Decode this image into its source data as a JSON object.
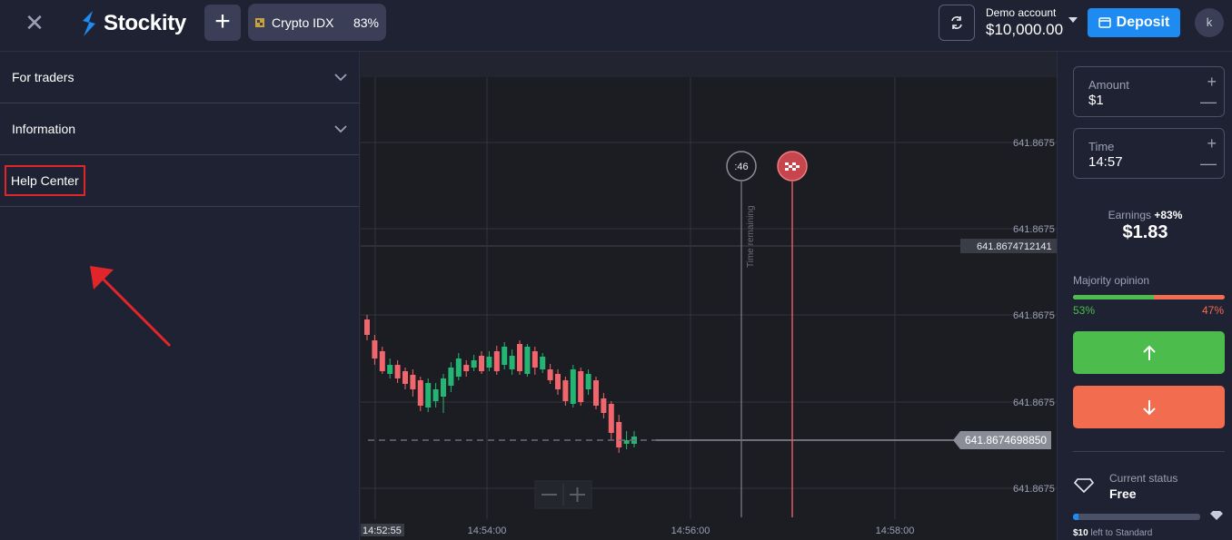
{
  "header": {
    "logo_text": "Stockity",
    "asset": {
      "name": "Crypto IDX",
      "payout": "83%"
    },
    "account": {
      "label": "Demo account",
      "balance": "$10,000.00"
    },
    "deposit_label": "Deposit",
    "avatar_initial": "k"
  },
  "sidebar": {
    "items": [
      {
        "label": "For traders",
        "expandable": true
      },
      {
        "label": "Information",
        "expandable": true
      },
      {
        "label": "Help Center",
        "expandable": false,
        "highlighted": true
      }
    ]
  },
  "chart": {
    "price_ticks": [
      "641.8675",
      "641.8675",
      "641.8675",
      "641.8675",
      "641.8675"
    ],
    "time_ticks": [
      "14:52:55",
      "14:54:00",
      "14:56:00",
      "14:58:00"
    ],
    "current_price": "641.8674698850",
    "line_price": "641.8674712141",
    "countdown": ":46",
    "time_remaining_label": "Time remaining",
    "colors": {
      "up": "#24b574",
      "down": "#f0666c",
      "background": "#1c1d23"
    }
  },
  "trade": {
    "amount_label": "Amount",
    "amount_value": "$1",
    "time_label": "Time",
    "time_value": "14:57",
    "earnings_label": "Earnings",
    "earnings_pct": "+83%",
    "earnings_value": "$1.83",
    "majority_label": "Majority opinion",
    "majority_up": "53%",
    "majority_down": "47%",
    "majority_up_fraction": 0.53,
    "status_label": "Current status",
    "status_value": "Free",
    "status_progress_fraction": 0.04,
    "status_note_amount": "$10",
    "status_note_text": "left to Standard"
  }
}
